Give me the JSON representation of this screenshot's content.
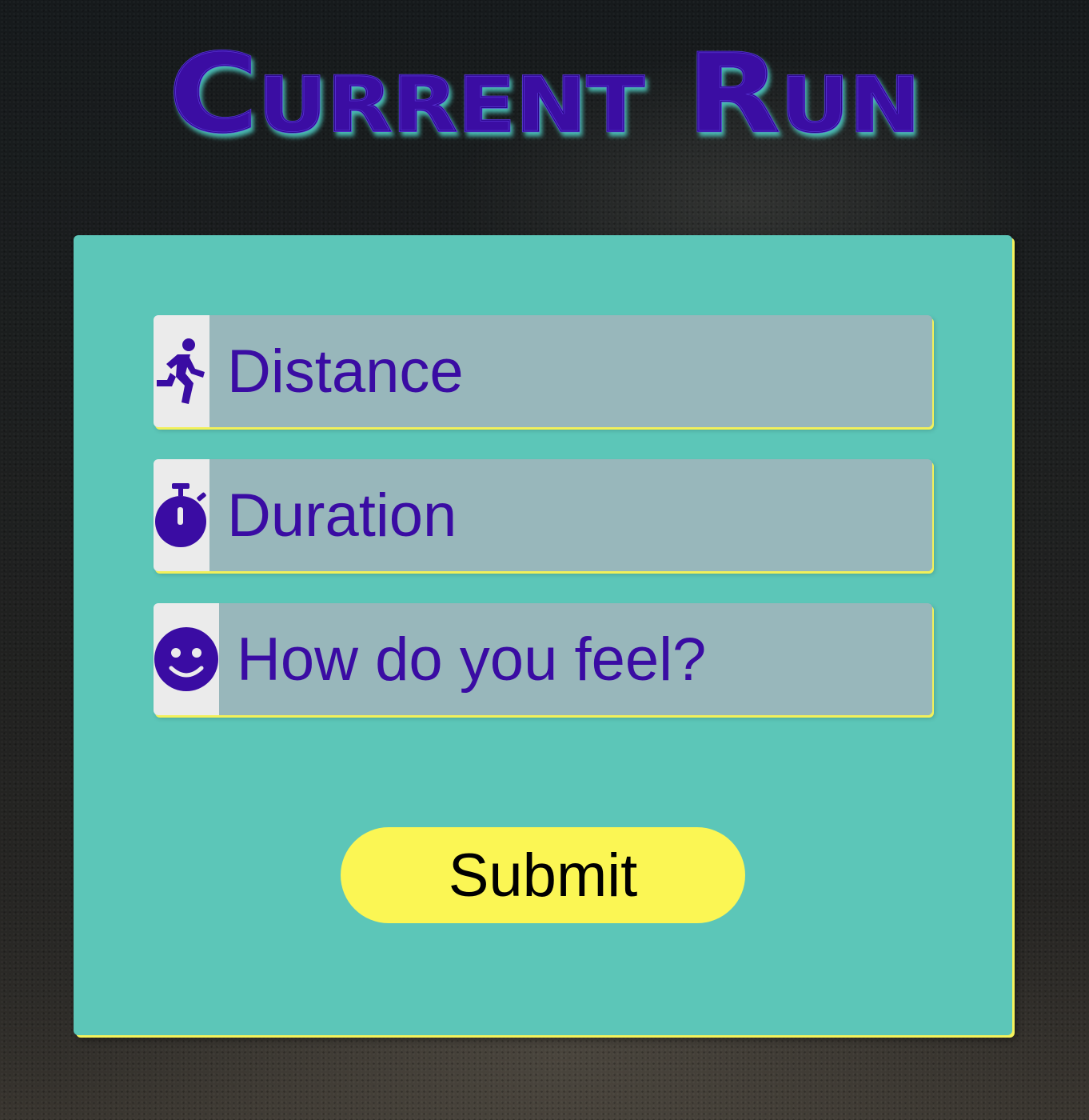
{
  "header": {
    "title": "Current Run"
  },
  "form": {
    "fields": [
      {
        "icon": "running-person-icon",
        "placeholder": "Distance"
      },
      {
        "icon": "stopwatch-icon",
        "placeholder": "Duration"
      },
      {
        "icon": "smiley-face-icon",
        "placeholder": "How do you feel?"
      }
    ],
    "submit_label": "Submit"
  },
  "colors": {
    "title_fill": "#3a0ca3",
    "title_glow": "#4ecdc4",
    "card_background": "#5cc6b8",
    "card_shadow": "#f4f25c",
    "icon_background": "#ebebeb",
    "input_background": "#98b7bb",
    "text_accent": "#3a0ca3",
    "button_background": "#fbf654"
  }
}
